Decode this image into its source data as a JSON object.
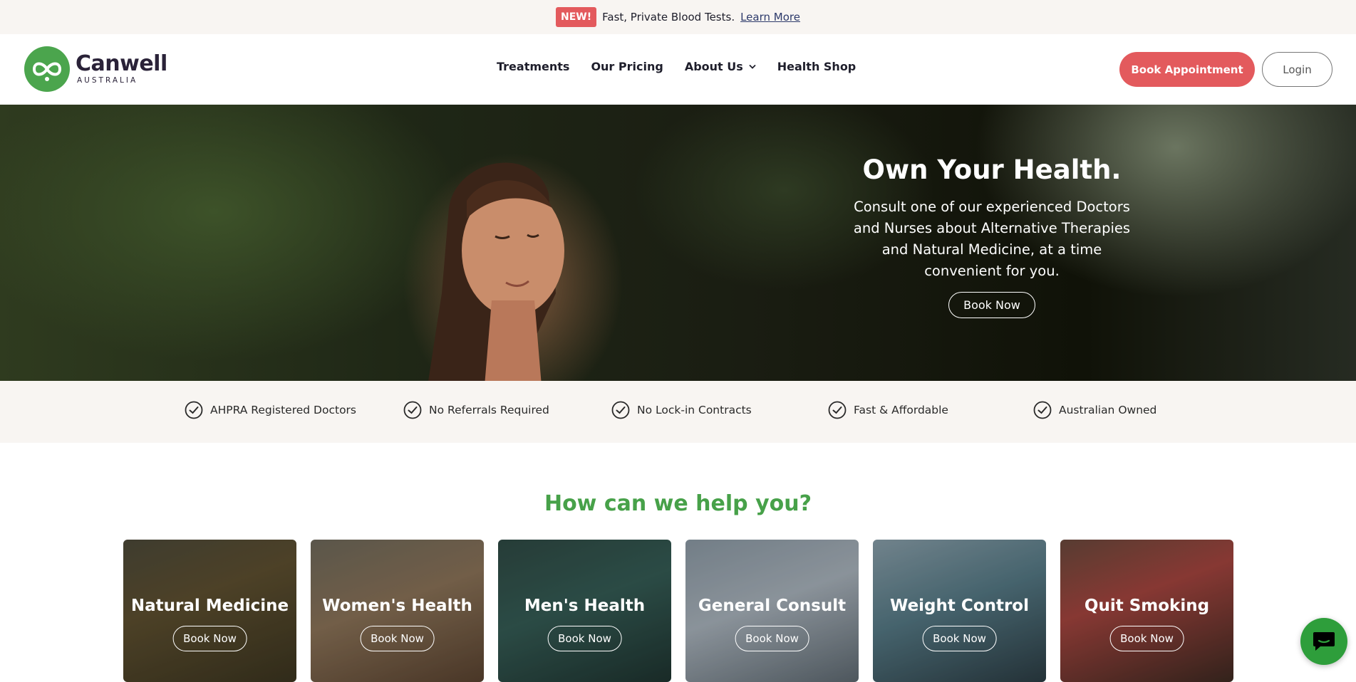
{
  "announcement": {
    "badge": "NEW!",
    "text": "Fast, Private Blood Tests.",
    "link": "Learn More"
  },
  "brand": {
    "name": "Canwell",
    "sub": "AUSTRALIA",
    "green": "#4ba54d",
    "accent": "#e35a5d"
  },
  "nav": {
    "items": [
      "Treatments",
      "Our Pricing",
      "About Us",
      "Health Shop"
    ],
    "book_label": "Book Appointment",
    "login_label": "Login"
  },
  "hero": {
    "title": "Own Your Health.",
    "body": "Consult one of our experienced Doctors and Nurses about Alternative Therapies and Natural Medicine, at a time convenient for you.",
    "button": "Book Now"
  },
  "trust": [
    "AHPRA Registered Doctors",
    "No Referrals Required",
    "No Lock-in Contracts",
    "Fast & Affordable",
    "Australian Owned"
  ],
  "help": {
    "title": "How can we help you?",
    "cards": [
      {
        "title": "Natural Medicine",
        "button": "Book Now"
      },
      {
        "title": "Women's Health",
        "button": "Book Now"
      },
      {
        "title": "Men's Health",
        "button": "Book Now"
      },
      {
        "title": "General Consult",
        "button": "Book Now"
      },
      {
        "title": "Weight Control",
        "button": "Book Now"
      },
      {
        "title": "Quit Smoking",
        "button": "Book Now"
      }
    ]
  },
  "icons": {
    "chat": "chat-bubble-icon",
    "check": "check-circle-icon",
    "chevron": "chevron-down-icon"
  }
}
